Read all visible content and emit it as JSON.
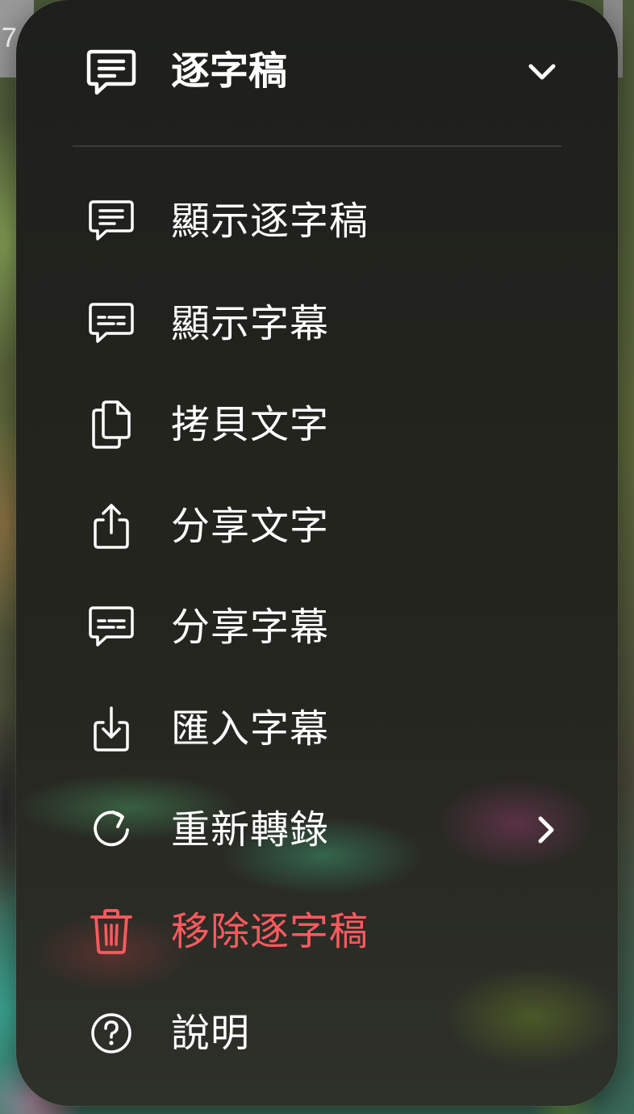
{
  "background": {
    "partial_text": "7"
  },
  "menu": {
    "header": {
      "title": "逐字稿",
      "icon": "transcript-bubble-icon",
      "trailing_icon": "chevron-down-icon"
    },
    "items": [
      {
        "label": "顯示逐字稿",
        "icon": "transcript-bubble-icon"
      },
      {
        "label": "顯示字幕",
        "icon": "captions-bubble-icon"
      },
      {
        "label": "拷貝文字",
        "icon": "copy-docs-icon"
      },
      {
        "label": "分享文字",
        "icon": "share-icon"
      },
      {
        "label": "分享字幕",
        "icon": "captions-bubble-icon"
      },
      {
        "label": "匯入字幕",
        "icon": "import-icon"
      },
      {
        "label": "重新轉錄",
        "icon": "redo-arrow-icon",
        "trailing_icon": "chevron-right-icon"
      },
      {
        "label": "移除逐字稿",
        "icon": "trash-icon",
        "destructive": true
      },
      {
        "label": "說明",
        "icon": "help-circle-icon"
      }
    ]
  },
  "colors": {
    "text": "#ffffff",
    "destructive": "#ff5a5f",
    "panel": "#1e1f1c"
  }
}
